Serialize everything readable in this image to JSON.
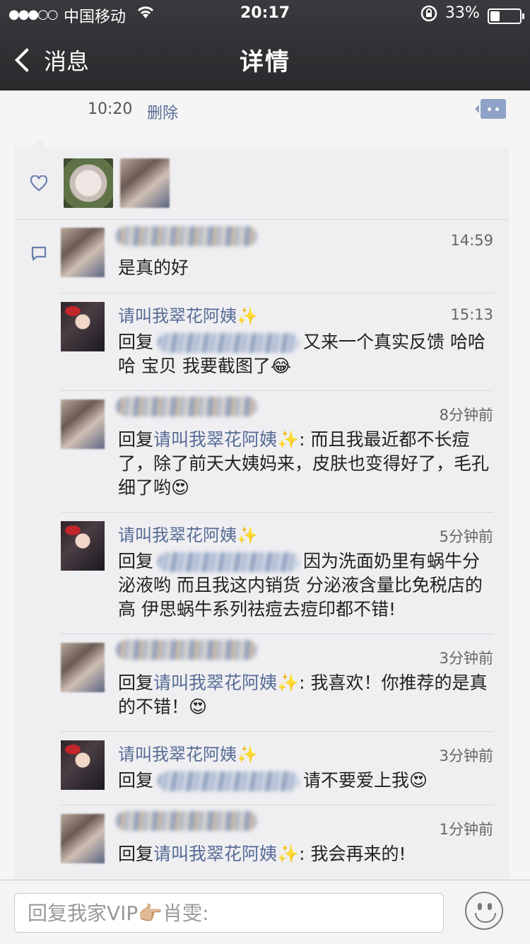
{
  "status_bar": {
    "signal": "●●●○○",
    "carrier": "中国移动",
    "wifi_icon": "wifi-icon",
    "time": "20:17",
    "battery_pct": "33%",
    "battery_level": 0.33
  },
  "nav": {
    "back_label": "消息",
    "title": "详情"
  },
  "post": {
    "time": "10:20",
    "delete_label": "删除"
  },
  "comments": [
    {
      "time": "14:59",
      "text": "是真的好"
    },
    {
      "name": "请叫我翠花阿姨✨",
      "time": "15:13",
      "prefix": "回复",
      "text": "又来一个真实反馈 哈哈哈 宝贝 我要截图了😂"
    },
    {
      "time": "8分钟前",
      "prefix": "回复",
      "reply_to": "请叫我翠花阿姨✨",
      "text": ": 而且我最近都不长痘了，除了前天大姨妈来，皮肤也变得好了，毛孔细了哟😍"
    },
    {
      "name": "请叫我翠花阿姨✨",
      "time": "5分钟前",
      "prefix": "回复",
      "text": "因为洗面奶里有蜗牛分泌液哟 而且我这内销货 分泌液含量比免税店的高 伊思蜗牛系列祛痘去痘印都不错!"
    },
    {
      "time": "3分钟前",
      "prefix": "回复",
      "reply_to": "请叫我翠花阿姨✨",
      "text": ": 我喜欢！你推荐的是真的不错！😍"
    },
    {
      "name": "请叫我翠花阿姨✨",
      "time": "3分钟前",
      "prefix": "回复",
      "text": "请不要爱上我😍"
    },
    {
      "time": "1分钟前",
      "prefix": "回复",
      "reply_to": "请叫我翠花阿姨✨",
      "text": ": 我会再来的!"
    }
  ],
  "input": {
    "placeholder": "回复我家VIP👉🏼肖雯:"
  }
}
